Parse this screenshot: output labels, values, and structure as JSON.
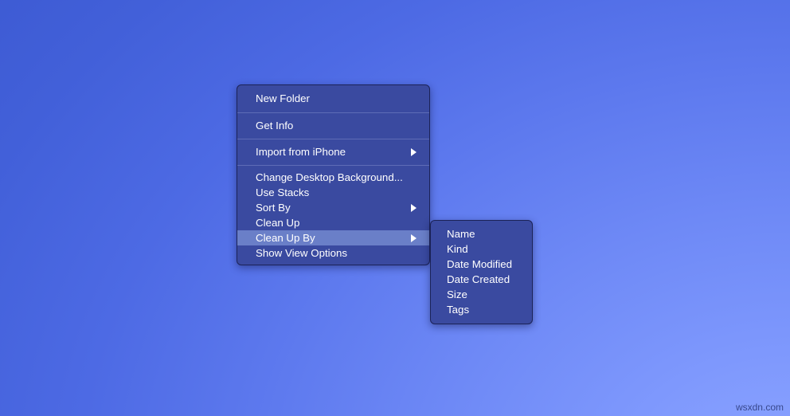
{
  "desktop": {
    "background_color_top_left": "#3a57cf",
    "background_color_bottom_right": "#8ea6ff",
    "watermark": "wsxdn.com"
  },
  "context_menu": {
    "name": "desktop-context-menu",
    "background_color": "#3a4aa0",
    "border_color": "#1c2358",
    "text_color": "#ffffff",
    "highlight_color": "#6a7fc8",
    "separator_color": "#5e6cb6",
    "groups": [
      {
        "items": [
          {
            "label": "New Folder",
            "has_submenu": false,
            "selected": false
          }
        ]
      },
      {
        "items": [
          {
            "label": "Get Info",
            "has_submenu": false,
            "selected": false
          }
        ]
      },
      {
        "items": [
          {
            "label": "Import from iPhone",
            "has_submenu": true,
            "selected": false
          }
        ]
      },
      {
        "items": [
          {
            "label": "Change Desktop Background...",
            "has_submenu": false,
            "selected": false
          },
          {
            "label": "Use Stacks",
            "has_submenu": false,
            "selected": false
          },
          {
            "label": "Sort By",
            "has_submenu": true,
            "selected": false
          },
          {
            "label": "Clean Up",
            "has_submenu": false,
            "selected": false
          },
          {
            "label": "Clean Up By",
            "has_submenu": true,
            "selected": true
          },
          {
            "label": "Show View Options",
            "has_submenu": false,
            "selected": false
          }
        ]
      }
    ]
  },
  "submenu": {
    "name": "clean-up-by-submenu",
    "parent_item": "Clean Up By",
    "items": [
      {
        "label": "Name"
      },
      {
        "label": "Kind"
      },
      {
        "label": "Date Modified"
      },
      {
        "label": "Date Created"
      },
      {
        "label": "Size"
      },
      {
        "label": "Tags"
      }
    ]
  }
}
